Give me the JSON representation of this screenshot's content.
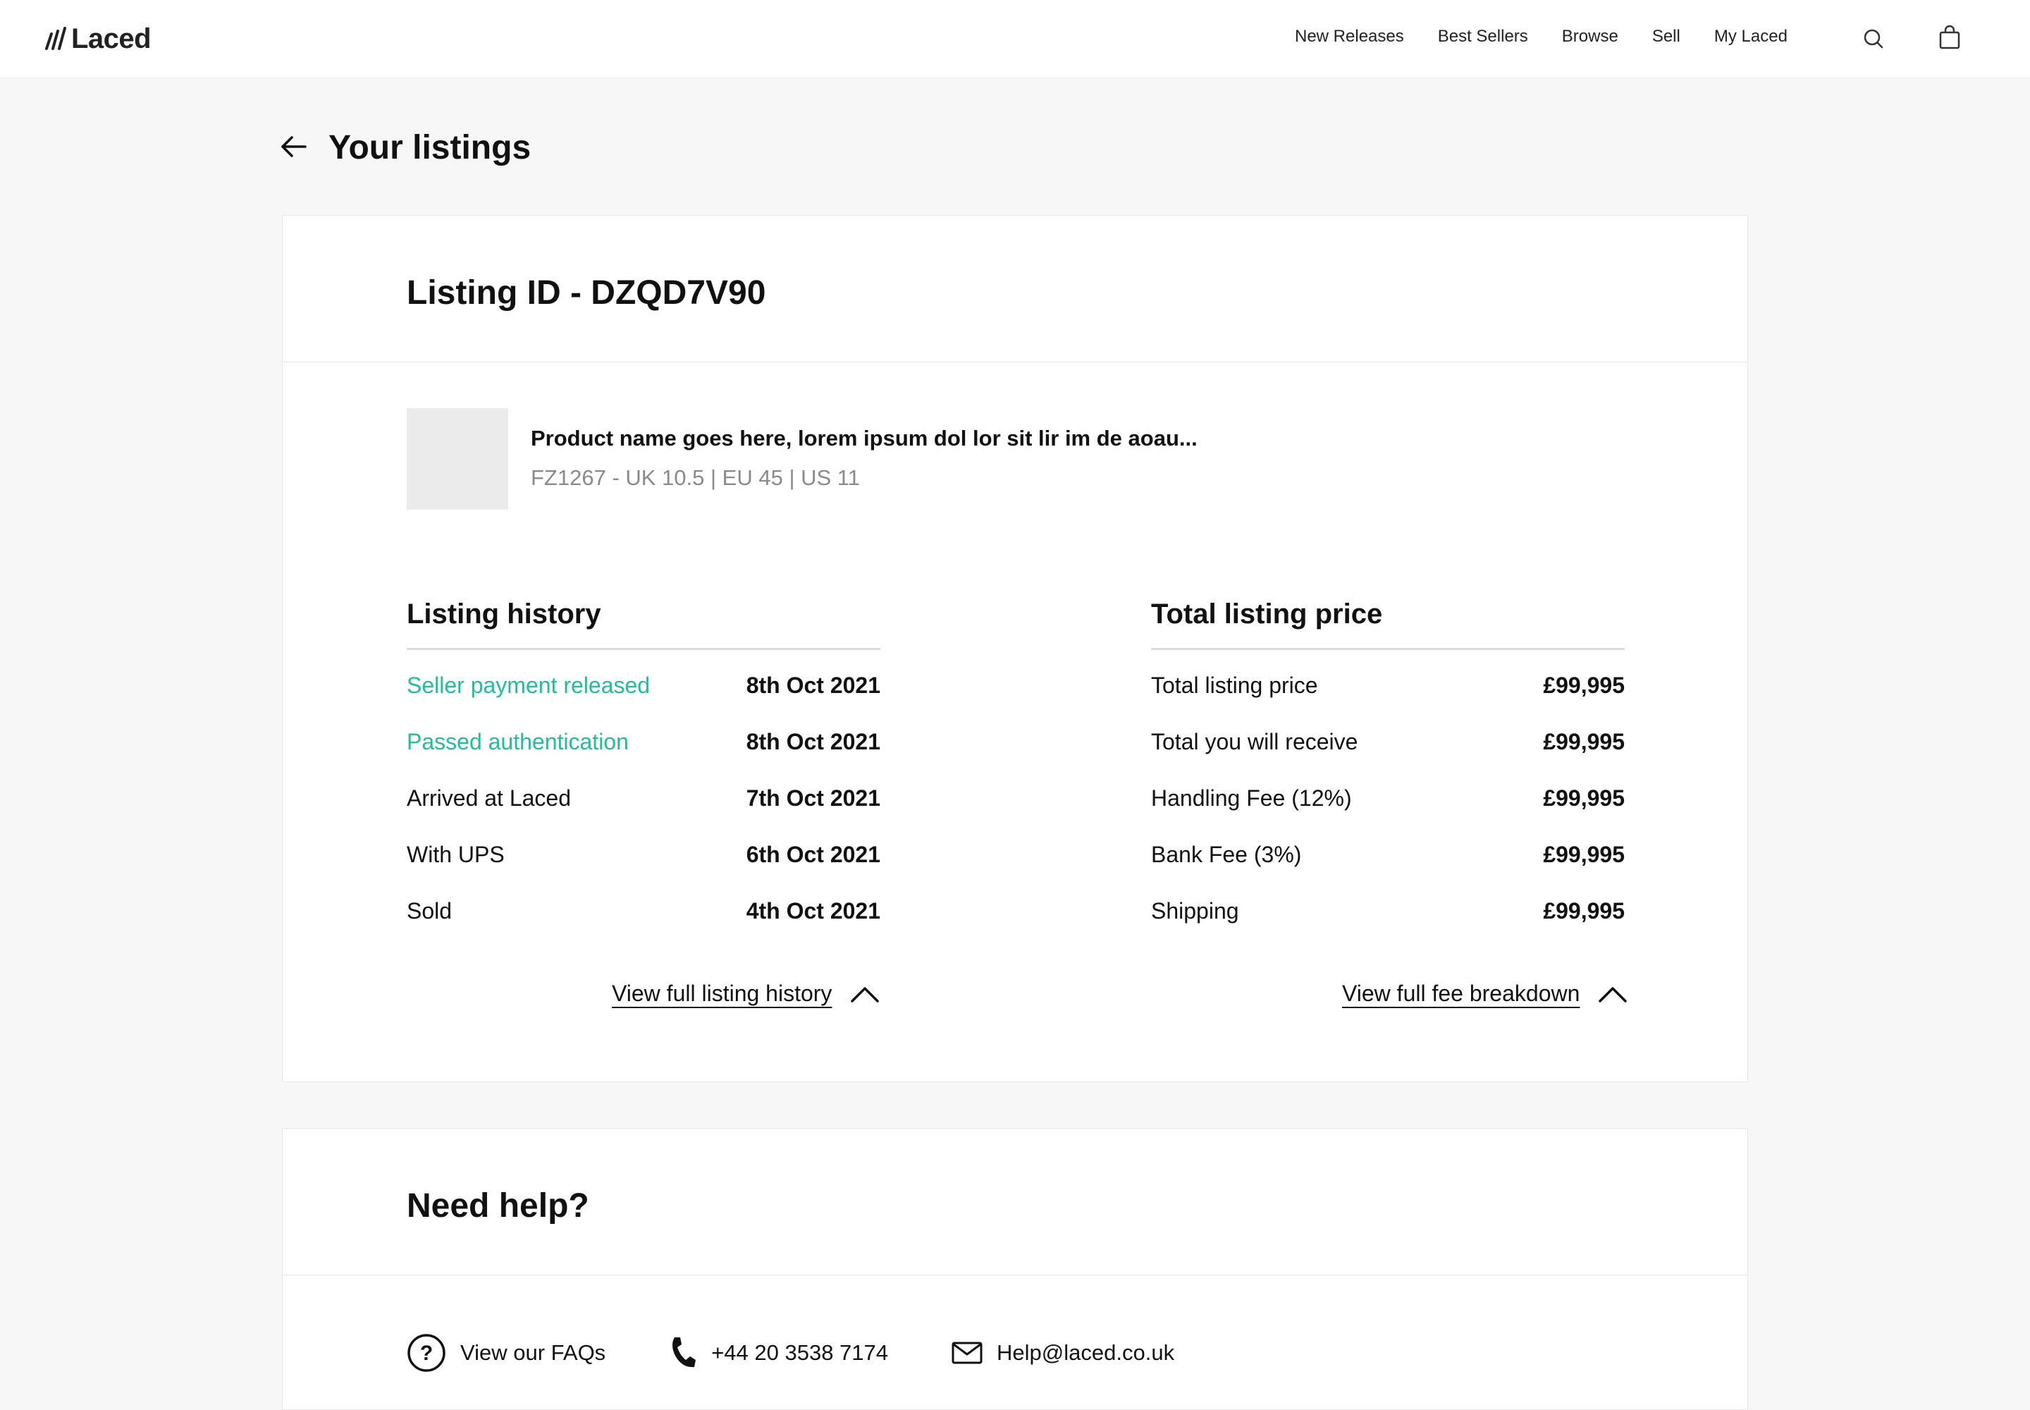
{
  "brand": {
    "name": "Laced"
  },
  "nav": {
    "items": [
      "New Releases",
      "Best Sellers",
      "Browse",
      "Sell",
      "My Laced"
    ]
  },
  "icons": {
    "search": "search-icon",
    "bag": "bag-icon",
    "back": "arrow-left-icon",
    "chevron": "chevron-up-icon",
    "question": "question-icon",
    "phone": "phone-icon",
    "mail": "mail-icon"
  },
  "page": {
    "title": "Your listings"
  },
  "listing": {
    "heading": "Listing ID - DZQD7V90",
    "product": {
      "name": "Product name goes here, lorem ipsum dol lor sit lir im de aoau...",
      "meta": "FZ1267 -  UK 10.5 | EU 45 | US 11"
    },
    "history": {
      "title": "Listing history",
      "rows": [
        {
          "label": "Seller payment released",
          "date": "8th Oct 2021",
          "highlight": true
        },
        {
          "label": "Passed authentication",
          "date": "8th Oct 2021",
          "highlight": true
        },
        {
          "label": "Arrived at Laced",
          "date": "7th Oct 2021",
          "highlight": false
        },
        {
          "label": "With UPS",
          "date": "6th Oct 2021",
          "highlight": false
        },
        {
          "label": "Sold",
          "date": "4th Oct 2021",
          "highlight": false
        }
      ],
      "toggle_label": "View full listing history"
    },
    "price": {
      "title": "Total listing price",
      "rows": [
        {
          "label": "Total listing price",
          "value": "£99,995"
        },
        {
          "label": "Total you will receive",
          "value": "£99,995"
        },
        {
          "label": "Handling Fee (12%)",
          "value": "£99,995"
        },
        {
          "label": "Bank Fee (3%)",
          "value": "£99,995"
        },
        {
          "label": "Shipping",
          "value": "£99,995"
        }
      ],
      "toggle_label": "View full fee breakdown"
    }
  },
  "help": {
    "title": "Need help?",
    "faq": "View our FAQs",
    "phone": "+44 20 3538 7174",
    "email": "Help@laced.co.uk"
  },
  "colors": {
    "accent_green": "#1fbf9a",
    "page_bg": "#f7f7f7"
  }
}
